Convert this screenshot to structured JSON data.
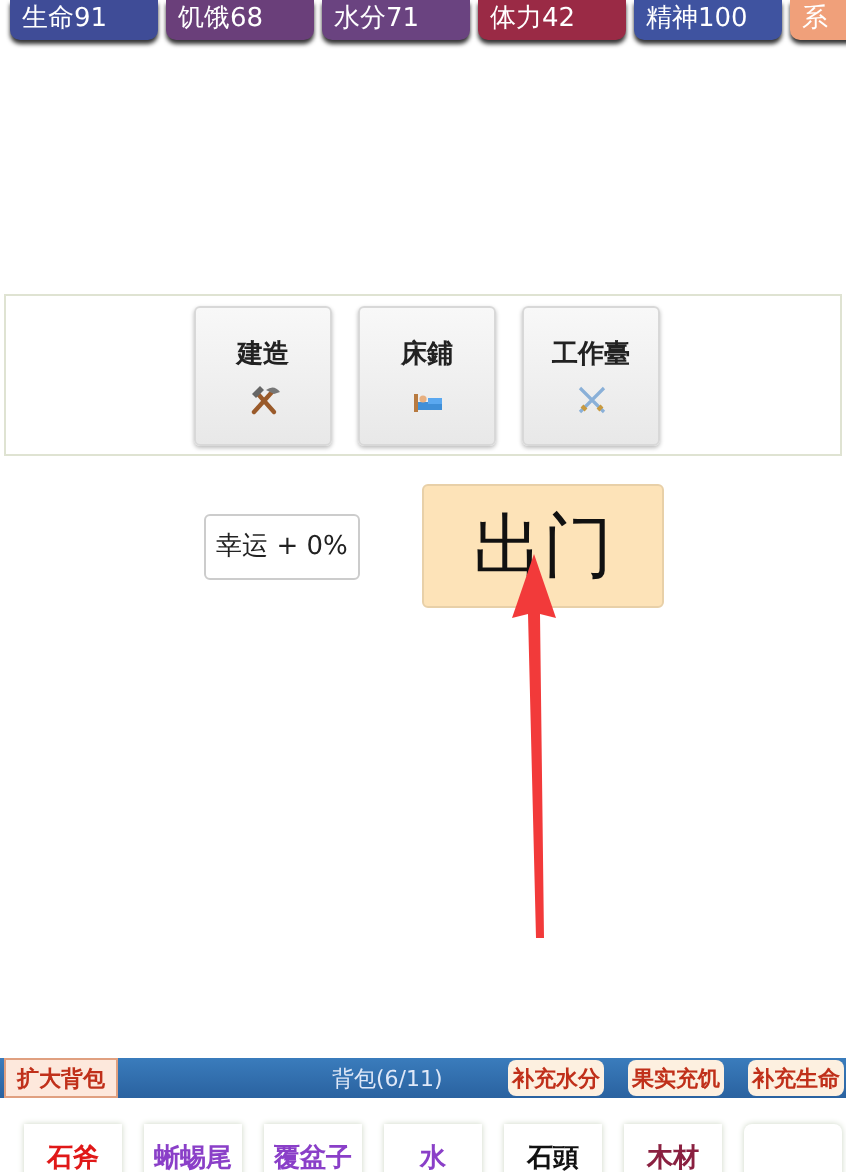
{
  "stats": [
    {
      "label": "生命91",
      "color": "#3f4c97"
    },
    {
      "label": "饥饿68",
      "color": "#6a3f7a"
    },
    {
      "label": "水分71",
      "color": "#6a4380"
    },
    {
      "label": "体力42",
      "color": "#9a2a45"
    },
    {
      "label": "精神100",
      "color": "#3f53a0"
    },
    {
      "label": "系",
      "color": "#f0a07a"
    }
  ],
  "buildings": [
    {
      "label": "建造",
      "kind": "hammer"
    },
    {
      "label": "床鋪",
      "kind": "bed"
    },
    {
      "label": "工作臺",
      "kind": "swords"
    }
  ],
  "luck": "幸运 + 0%",
  "go_out": "出门",
  "backpack": {
    "expand": "扩大背包",
    "title": "背包(6/11)",
    "actions": [
      "补充水分",
      "果实充饥",
      "补充生命"
    ]
  },
  "items": [
    {
      "kind": "item",
      "label": "石斧",
      "color": "#e01818"
    },
    {
      "kind": "item",
      "label": "蜥蜴尾",
      "color": "#8a3fc8"
    },
    {
      "kind": "item",
      "label": "覆盆子",
      "color": "#8a3fc8"
    },
    {
      "kind": "item",
      "label": "水",
      "color": "#8a3fc8"
    },
    {
      "kind": "item",
      "label": "石頭",
      "color": "#111111"
    },
    {
      "kind": "item",
      "label": "木材",
      "color": "#8a2040"
    },
    {
      "kind": "empty"
    }
  ]
}
